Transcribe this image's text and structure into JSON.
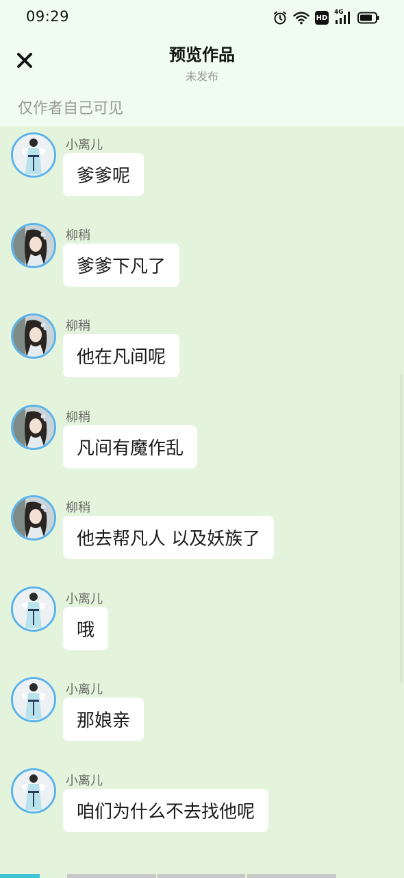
{
  "status_bar": {
    "time": "09:29",
    "icons": [
      "alarm-icon",
      "wifi-icon",
      "hd-icon",
      "signal-4g-icon",
      "battery-icon"
    ],
    "hd_label": "HD",
    "network_label": "4G"
  },
  "header": {
    "title": "预览作品",
    "subtitle": "未发布",
    "close_icon": "close-icon"
  },
  "visibility_note": "仅作者自己可见",
  "colors": {
    "background": "#e4f4dc",
    "top_background": "#effcef",
    "bubble": "#ffffff",
    "avatar_border": "#5ab3ec",
    "tab_active": "#3fc4d8",
    "tab_inactive": "#c8c8c8"
  },
  "messages": [
    {
      "sender": "小离儿",
      "avatar": "avatar-xiaolier",
      "text": "爹爹呢"
    },
    {
      "sender": "柳稍",
      "avatar": "avatar-liushao",
      "text": "爹爹下凡了"
    },
    {
      "sender": "柳稍",
      "avatar": "avatar-liushao",
      "text": "他在凡间呢"
    },
    {
      "sender": "柳稍",
      "avatar": "avatar-liushao",
      "text": "凡间有魔作乱"
    },
    {
      "sender": "柳稍",
      "avatar": "avatar-liushao",
      "text": "他去帮凡人 以及妖族了"
    },
    {
      "sender": "小离儿",
      "avatar": "avatar-xiaolier",
      "text": "哦"
    },
    {
      "sender": "小离儿",
      "avatar": "avatar-xiaolier",
      "text": "那娘亲"
    },
    {
      "sender": "小离儿",
      "avatar": "avatar-xiaolier",
      "text": "咱们为什么不去找他呢"
    }
  ]
}
